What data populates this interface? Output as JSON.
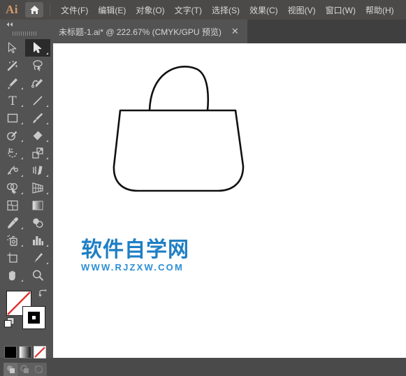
{
  "app": {
    "name": "Ai",
    "home_icon": "home-icon"
  },
  "menubar": {
    "items": [
      {
        "label": "文件(F)",
        "name": "menu-file"
      },
      {
        "label": "编辑(E)",
        "name": "menu-edit"
      },
      {
        "label": "对象(O)",
        "name": "menu-object"
      },
      {
        "label": "文字(T)",
        "name": "menu-type"
      },
      {
        "label": "选择(S)",
        "name": "menu-select"
      },
      {
        "label": "效果(C)",
        "name": "menu-effect"
      },
      {
        "label": "视图(V)",
        "name": "menu-view"
      },
      {
        "label": "窗口(W)",
        "name": "menu-window"
      },
      {
        "label": "帮助(H)",
        "name": "menu-help"
      }
    ]
  },
  "document_tab": {
    "title": "未标题-1.ai* @ 222.67% (CMYK/GPU 预览)",
    "close_label": "✕",
    "zoom_percent": "222.67%",
    "color_mode": "CMYK",
    "preview_mode": "GPU 预览",
    "modified": true
  },
  "toolbar": {
    "collapse_label": "◀◀",
    "tools": [
      {
        "name": "selection-tool",
        "label": "选择工具",
        "active": false,
        "flyout": false
      },
      {
        "name": "direct-selection-tool",
        "label": "直接选择工具",
        "active": true,
        "flyout": true
      },
      {
        "name": "magic-wand-tool",
        "label": "魔棒工具",
        "active": false,
        "flyout": false
      },
      {
        "name": "lasso-tool",
        "label": "套索工具",
        "active": false,
        "flyout": false
      },
      {
        "name": "pen-tool",
        "label": "钢笔工具",
        "active": false,
        "flyout": true
      },
      {
        "name": "curvature-tool",
        "label": "曲率工具",
        "active": false,
        "flyout": false
      },
      {
        "name": "type-tool",
        "label": "文字工具",
        "active": false,
        "flyout": true
      },
      {
        "name": "line-segment-tool",
        "label": "直线段工具",
        "active": false,
        "flyout": true
      },
      {
        "name": "rectangle-tool",
        "label": "矩形工具",
        "active": false,
        "flyout": true
      },
      {
        "name": "paintbrush-tool",
        "label": "画笔工具",
        "active": false,
        "flyout": true
      },
      {
        "name": "shaper-tool",
        "label": "Shaper 工具",
        "active": false,
        "flyout": true
      },
      {
        "name": "eraser-tool",
        "label": "橡皮擦工具",
        "active": false,
        "flyout": true
      },
      {
        "name": "rotate-tool",
        "label": "旋转工具",
        "active": false,
        "flyout": true
      },
      {
        "name": "scale-tool",
        "label": "比例缩放工具",
        "active": false,
        "flyout": true
      },
      {
        "name": "width-tool",
        "label": "宽度工具",
        "active": false,
        "flyout": true
      },
      {
        "name": "free-transform-tool",
        "label": "自由变换工具",
        "active": false,
        "flyout": true
      },
      {
        "name": "shape-builder-tool",
        "label": "形状生成器工具",
        "active": false,
        "flyout": true
      },
      {
        "name": "perspective-grid-tool",
        "label": "透视网格工具",
        "active": false,
        "flyout": true
      },
      {
        "name": "mesh-tool",
        "label": "网格工具",
        "active": false,
        "flyout": false
      },
      {
        "name": "gradient-tool",
        "label": "渐变工具",
        "active": false,
        "flyout": false
      },
      {
        "name": "eyedropper-tool",
        "label": "吸管工具",
        "active": false,
        "flyout": true
      },
      {
        "name": "blend-tool",
        "label": "混合工具",
        "active": false,
        "flyout": false
      },
      {
        "name": "symbol-sprayer-tool",
        "label": "符号喷枪工具",
        "active": false,
        "flyout": true
      },
      {
        "name": "column-graph-tool",
        "label": "柱形图工具",
        "active": false,
        "flyout": true
      },
      {
        "name": "artboard-tool",
        "label": "画板工具",
        "active": false,
        "flyout": false
      },
      {
        "name": "slice-tool",
        "label": "切片工具",
        "active": false,
        "flyout": true
      },
      {
        "name": "hand-tool",
        "label": "抓手工具",
        "active": false,
        "flyout": true
      },
      {
        "name": "zoom-tool",
        "label": "缩放工具",
        "active": false,
        "flyout": false
      }
    ],
    "fill": {
      "name": "fill-swatch",
      "value": "none",
      "color": "#ffffff"
    },
    "stroke": {
      "name": "stroke-swatch",
      "value": "black",
      "color": "#000000"
    },
    "swap_icon": "swap-fill-stroke-icon",
    "default_icon": "default-fill-stroke-icon",
    "color_modes": [
      {
        "name": "color-mode-color",
        "label": "颜色",
        "selected": false,
        "color": "#000000"
      },
      {
        "name": "color-mode-gradient",
        "label": "渐变",
        "selected": false
      },
      {
        "name": "color-mode-none",
        "label": "无",
        "selected": true
      }
    ],
    "draw_modes": [
      {
        "name": "draw-normal-mode",
        "label": "正常绘图",
        "active": true
      },
      {
        "name": "draw-behind-mode",
        "label": "背面绘图",
        "active": false
      },
      {
        "name": "draw-inside-mode",
        "label": "内部绘图",
        "active": false
      }
    ]
  },
  "canvas": {
    "artwork_name": "handbag-outline",
    "stroke_color": "#000000",
    "fill_color": "#ffffff",
    "background": "#ffffff"
  },
  "watermark": {
    "title": "软件自学网",
    "url": "WWW.RJZXW.COM",
    "color": "#1f7fc4"
  }
}
